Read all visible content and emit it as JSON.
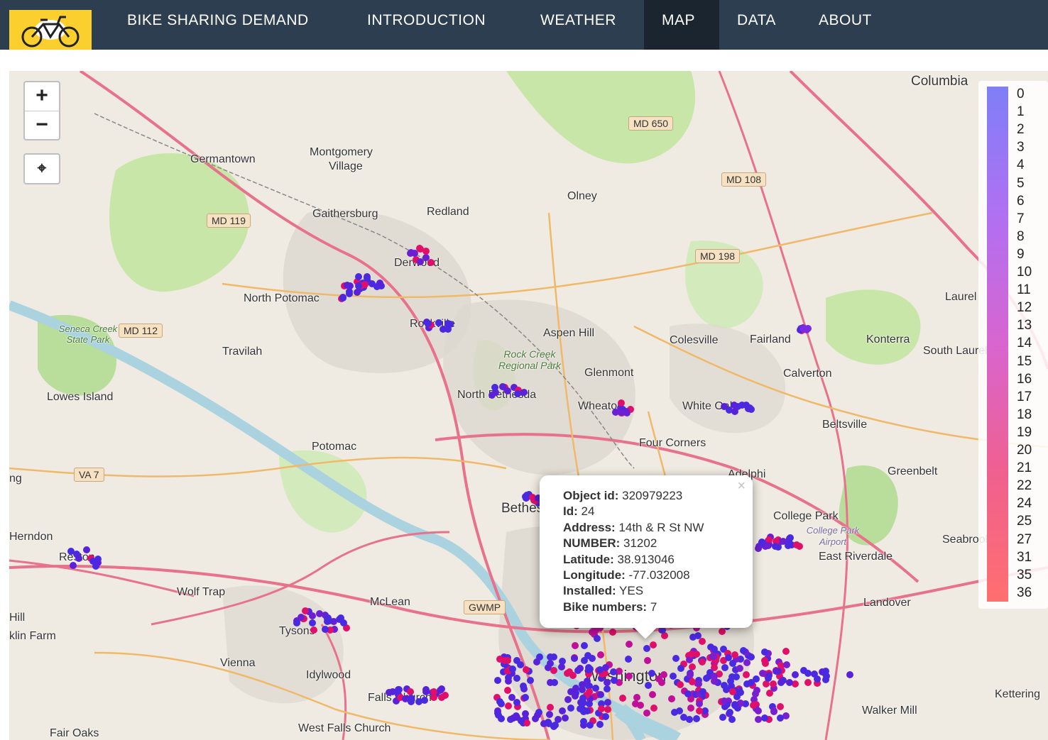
{
  "nav": {
    "brand_icon": "bicycle-logo",
    "links": [
      {
        "label": "BIKE SHARING DEMAND",
        "active": false
      },
      {
        "label": "INTRODUCTION",
        "active": false
      },
      {
        "label": "WEATHER",
        "active": false
      },
      {
        "label": "MAP",
        "active": true
      },
      {
        "label": "DATA",
        "active": false
      },
      {
        "label": "ABOUT",
        "active": false
      }
    ]
  },
  "map": {
    "zoom_in_icon": "plus-icon",
    "zoom_out_icon": "minus-icon",
    "locate_icon": "crosshair-icon",
    "zoom_in_label": "+",
    "zoom_out_label": "−",
    "locate_label": "⌖",
    "legend_labels": [
      "0",
      "1",
      "2",
      "3",
      "4",
      "5",
      "6",
      "7",
      "8",
      "9",
      "10",
      "11",
      "12",
      "13",
      "14",
      "15",
      "16",
      "17",
      "18",
      "19",
      "20",
      "21",
      "22",
      "24",
      "25",
      "27",
      "31",
      "35",
      "36"
    ],
    "legend_colors": {
      "low": "#7f7ff7",
      "high": "#ff6f6f"
    },
    "place_labels": [
      "Columbia",
      "Germantown",
      "Montgomery",
      "Village",
      "Gaithersburg",
      "Redland",
      "Olney",
      "Derwood",
      "North Potomac",
      "Rockville",
      "Aspen Hill",
      "Colesville",
      "Fairland",
      "Konterra",
      "South Laurel",
      "Travilah",
      "Glenmont",
      "Calverton",
      "Lowes Island",
      "North Bethesda",
      "Wheaton",
      "White Oak",
      "Beltsville",
      "Potomac",
      "Four Corners",
      "Adelphi",
      "Greenbelt",
      "Bethesda",
      "College Park",
      "Herndon",
      "Reston",
      "East Riverdale",
      "Wolf Trap",
      "McLean",
      "Landover",
      "Tysons",
      "Vienna",
      "Idylwood",
      "Falls Church",
      "Washington",
      "West Falls Church",
      "Walker Mill",
      "Fair Oaks",
      "Seabrook",
      "Kettering",
      "Laurel",
      "Seneca Creek State Park",
      "Rock Creek Regional Park",
      "College Park Airport",
      "klin Farm",
      "Hill",
      "ng"
    ],
    "road_shields": [
      "MD 650",
      "MD 108",
      "MD 119",
      "MD 198",
      "MD 112",
      "VA 7",
      "GWMP"
    ],
    "popup": {
      "close_label": "×",
      "fields": [
        {
          "key": "Object id:",
          "value": "320979223"
        },
        {
          "key": "Id:",
          "value": "24"
        },
        {
          "key": "Address:",
          "value": "14th & R St NW"
        },
        {
          "key": "NUMBER:",
          "value": "31202"
        },
        {
          "key": "Latitude:",
          "value": "38.913046"
        },
        {
          "key": "Longitude:",
          "value": "-77.032008"
        },
        {
          "key": "Installed:",
          "value": "YES"
        },
        {
          "key": "Bike numbers:",
          "value": "7"
        }
      ]
    }
  }
}
